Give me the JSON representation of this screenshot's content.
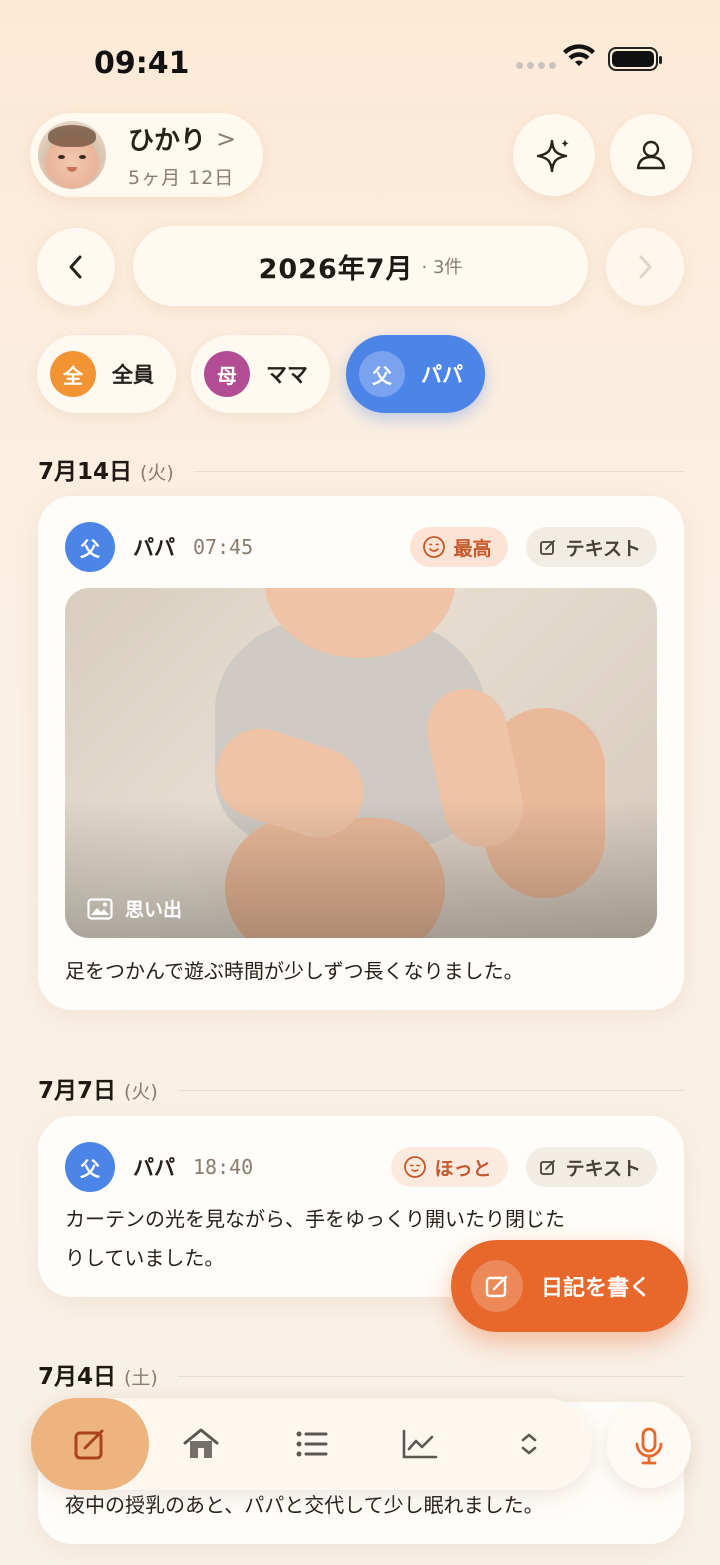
{
  "status": {
    "time": "09:41"
  },
  "profile": {
    "name": "ひかり",
    "chevron": ">",
    "age": "5ヶ月 12日"
  },
  "header_actions": {
    "sparkle_icon": "sparkle-icon",
    "account_icon": "person-icon"
  },
  "month": {
    "title": "2026年7月",
    "count": "· 3件",
    "prev_icon": "chevron-left-icon",
    "next_icon": "chevron-right-icon"
  },
  "filters": [
    {
      "badge": "全",
      "label": "全員",
      "color": "#f39434",
      "active": false
    },
    {
      "badge": "母",
      "label": "ママ",
      "color": "#b24d93",
      "active": false
    },
    {
      "badge": "父",
      "label": "パパ",
      "color": "#4c84e8",
      "active": true
    }
  ],
  "sections": [
    {
      "date": "7月14日",
      "weekday": "(火)",
      "entry": {
        "badge": "父",
        "author": "パパ",
        "time": "07:45",
        "mood": "最高",
        "type": "テキスト",
        "photo_label": "思い出",
        "text": "足をつかんで遊ぶ時間が少しずつ長くなりました。"
      }
    },
    {
      "date": "7月7日",
      "weekday": "(火)",
      "entry": {
        "badge": "父",
        "author": "パパ",
        "time": "18:40",
        "mood": "ほっと",
        "type": "テキスト",
        "text_line1": "カーテンの光を見ながら、手をゆっくり開いたり閉じた",
        "text_line2": "りしていました。"
      }
    },
    {
      "date": "7月4日",
      "weekday": "(土)",
      "entry": {
        "text": "夜中の授乳のあと、パパと交代して少し眠れました。"
      }
    }
  ],
  "fab": {
    "label": "日記を書く"
  },
  "tabs": [
    "compose-icon",
    "home-icon",
    "list-icon",
    "chart-icon",
    "expand-icon"
  ],
  "mic_icon": "microphone-icon",
  "colors": {
    "accent": "#e8672b",
    "dad": "#4c84e8",
    "mom": "#b24d93",
    "all": "#f39434"
  }
}
